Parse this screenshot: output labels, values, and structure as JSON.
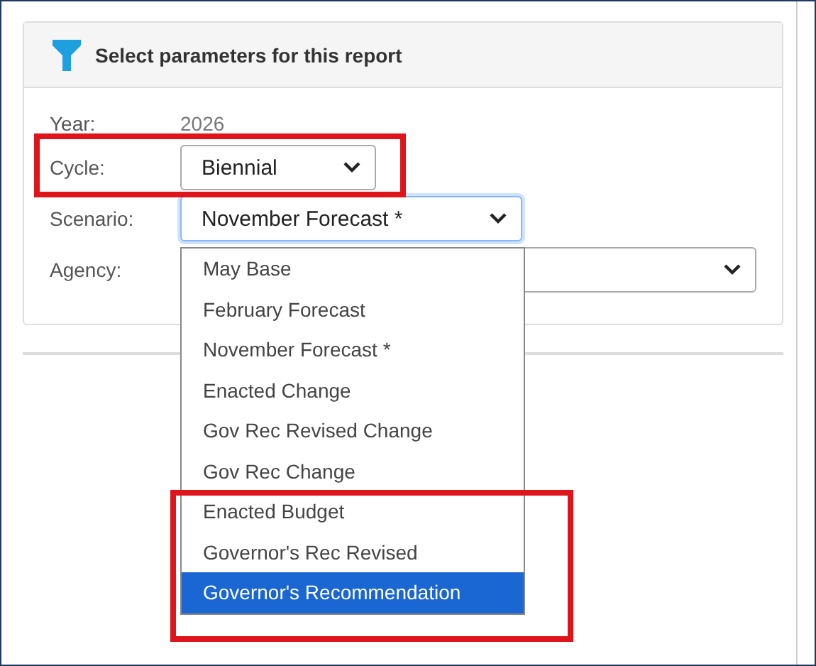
{
  "panel": {
    "title": "Select parameters for this report"
  },
  "fields": [
    {
      "label": "Year:",
      "kind": "text",
      "value": "2026",
      "highlighted": false
    },
    {
      "label": "Cycle:",
      "kind": "select",
      "value": "Biennial",
      "focused": false,
      "highlighted": true
    },
    {
      "label": "Scenario:",
      "kind": "select",
      "value": "November Forecast *",
      "focused": true,
      "highlighted": false
    },
    {
      "label": "Agency:",
      "kind": "select",
      "focused": false,
      "highlighted": false
    }
  ],
  "dropdown": {
    "options": [
      {
        "label": "May Base",
        "selected": false
      },
      {
        "label": "February Forecast",
        "selected": false
      },
      {
        "label": "November Forecast *",
        "selected": false
      },
      {
        "label": "Enacted Change",
        "selected": false
      },
      {
        "label": "Gov Rec Revised Change",
        "selected": false
      },
      {
        "label": "Gov Rec Change",
        "selected": false
      }
    ],
    "highlighted_options": [
      {
        "label": "Enacted Budget",
        "selected": false
      },
      {
        "label": "Governor's Rec Revised",
        "selected": false
      },
      {
        "label": "Governor's Recommendation",
        "selected": true
      }
    ]
  }
}
